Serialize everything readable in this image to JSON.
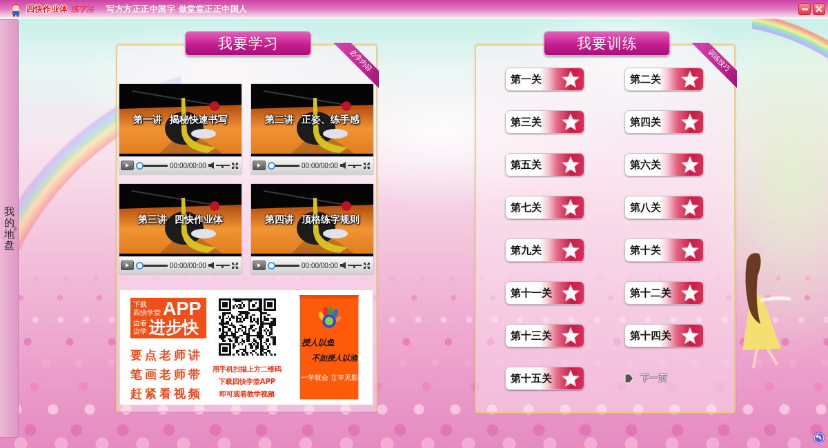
{
  "title_bar": {
    "brand": "四快作业体",
    "brand_suffix": "练字法",
    "slogan": "写方方正正中国字 做堂堂正正中国人"
  },
  "side_tab": {
    "label": "我的地盘"
  },
  "learn_panel": {
    "title": "我要学习",
    "corner_ribbon": "必学内容",
    "videos": [
      {
        "title": "第一讲 揭秘快速书写",
        "time": "00:00/00:00",
        "level": 0,
        "volume": {
          "level": 0.5
        }
      },
      {
        "title": "第二讲 正姿、练手感",
        "time": "00:00/00:00",
        "level": 0,
        "volume": {
          "level": 0.5
        }
      },
      {
        "title": "第三讲 四快作业体",
        "time": "00:00/00:00",
        "level": 0,
        "volume": {
          "level": 0.5
        }
      },
      {
        "title": "第四讲 顶格练字规则",
        "time": "00:00/00:00",
        "level": 0,
        "volume": {
          "level": 0.5
        }
      }
    ],
    "promo": {
      "badge": [
        {
          "small": [
            "下载",
            "四快学堂"
          ],
          "big": "APP"
        },
        {
          "small": [
            "边看",
            "边学"
          ],
          "big": "进步快"
        }
      ],
      "slogans": [
        "要点老师讲",
        "笔画老师带",
        "赶紧看视频"
      ],
      "qr_captions": [
        "用手机扫描上方二维码",
        "下载四快学堂APP",
        "即可观看教学视频"
      ],
      "phone": {
        "calligraphy": [
          "授人以鱼",
          "不如授人以渔"
        ],
        "motto": [
          "一学就会",
          "立竿见影"
        ]
      }
    }
  },
  "train_panel": {
    "title": "我要训练",
    "corner_ribbon": "训练技巧",
    "stages": [
      "第一关",
      "第二关",
      "第三关",
      "第四关",
      "第五关",
      "第六关",
      "第七关",
      "第八关",
      "第九关",
      "第十关",
      "第十一关",
      "第十二关",
      "第十三关",
      "第十四关",
      "第十五关"
    ],
    "next_page": "下一页"
  }
}
